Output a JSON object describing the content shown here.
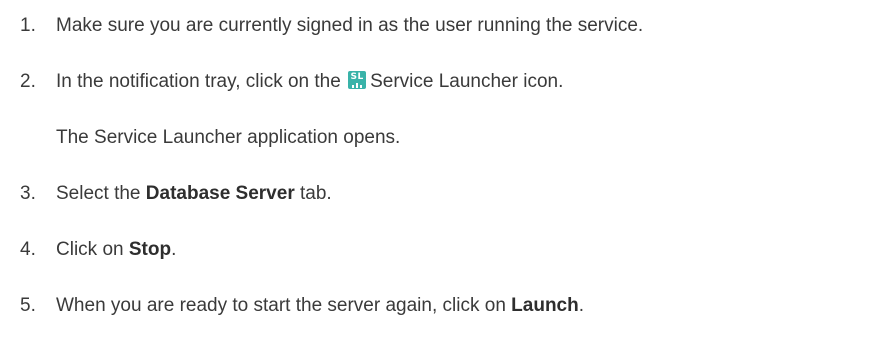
{
  "steps": [
    {
      "number": "1.",
      "text": "Make sure you are currently signed in as the user running the service."
    },
    {
      "number": "2.",
      "text_before": "In the notification tray, click on the",
      "icon": "service-launcher-icon",
      "icon_label": "SL",
      "text_after": "Service Launcher icon.",
      "result": "The Service Launcher application opens."
    },
    {
      "number": "3.",
      "text_before": "Select the",
      "bold": "Database Server",
      "text_after": "tab."
    },
    {
      "number": "4.",
      "text_before": "Click on",
      "bold": "Stop",
      "text_after": "."
    },
    {
      "number": "5.",
      "text_before": "When you are ready to start the server again, click on",
      "bold": "Launch",
      "text_after": "."
    }
  ],
  "colors": {
    "text": "#3a3a3a",
    "icon_background": "#39b3a9"
  }
}
